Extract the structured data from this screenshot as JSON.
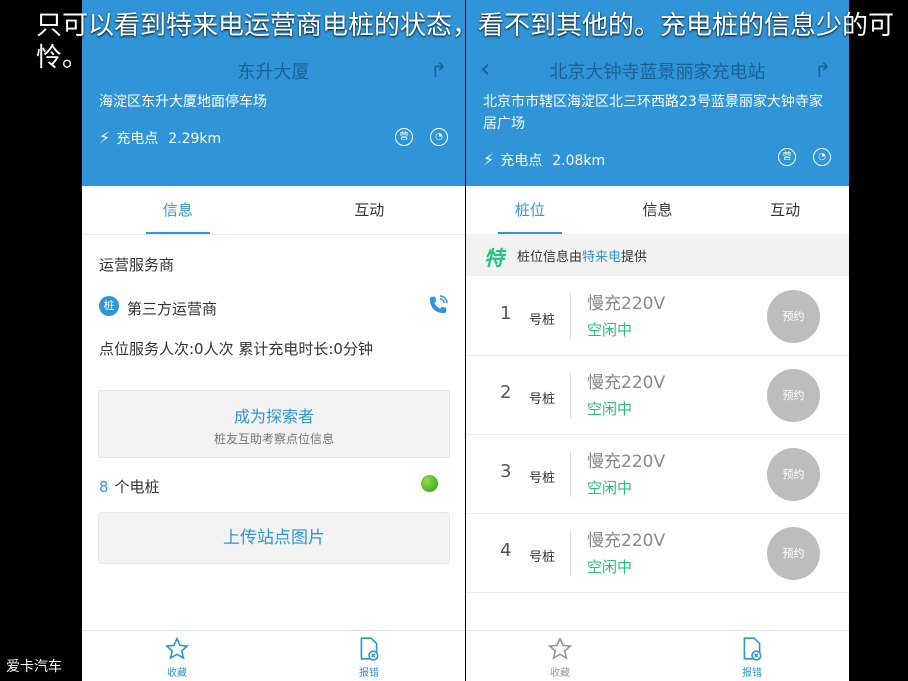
{
  "caption": "只可以看到特来电运营商电桩的状态，看不到其他的。充电桩的信息少的可怜。",
  "watermark": "爱卡汽车",
  "left": {
    "title": "东升大厦",
    "address": "海淀区东升大厦地面停车场",
    "type_label": "充电点",
    "distance": "2.29km",
    "badge_1": "营",
    "tabs": [
      "信息",
      "互动"
    ],
    "active_tab": "信息",
    "operator_section": "运营服务商",
    "operator_badge": "桩",
    "operator_name": "第三方运营商",
    "stats": "点位服务人次:0人次   累计充电时长:0分钟",
    "explorer": {
      "title": "成为探索者",
      "subtitle": "桩友互助考察点位信息"
    },
    "pile_count": "8",
    "pile_count_label": "个电桩",
    "upload_label": "上传站点图片",
    "bottom": {
      "favorite": "收藏",
      "report": "报错"
    }
  },
  "right": {
    "title": "北京大钟寺蓝景丽家充电站",
    "address": "北京市市辖区海淀区北三环西路23号蓝景丽家大钟寺家居广场",
    "type_label": "充电点",
    "distance": "2.08km",
    "badge_1": "营",
    "tabs": [
      "桩位",
      "信息",
      "互动"
    ],
    "active_tab": "桩位",
    "provider": {
      "logo": "特",
      "prefix": "桩位信息由",
      "brand": "特来电",
      "suffix": "提供"
    },
    "slots": [
      {
        "number": "1",
        "unit": "号桩",
        "type": "慢充220V",
        "status": "空闲中",
        "action": "预约"
      },
      {
        "number": "2",
        "unit": "号桩",
        "type": "慢充220V",
        "status": "空闲中",
        "action": "预约"
      },
      {
        "number": "3",
        "unit": "号桩",
        "type": "慢充220V",
        "status": "空闲中",
        "action": "预约"
      },
      {
        "number": "4",
        "unit": "号桩",
        "type": "慢充220V",
        "status": "空闲中",
        "action": "预约"
      }
    ],
    "bottom": {
      "favorite": "收藏",
      "report": "报错"
    }
  },
  "colors": {
    "brand_blue": "#2f95d8",
    "status_green": "#27c27a",
    "book_gray": "#bdbdbd"
  }
}
